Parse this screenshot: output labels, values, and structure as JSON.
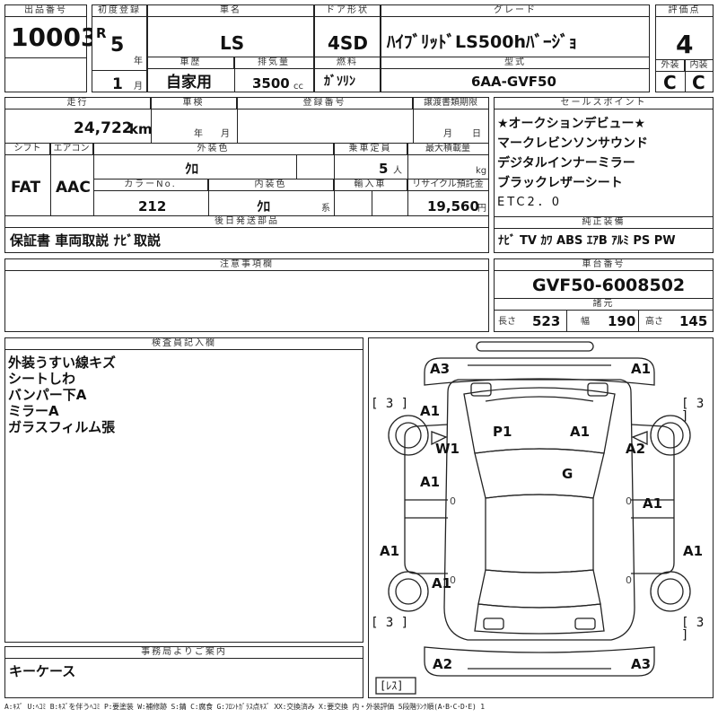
{
  "sheet": {
    "lot_label": "出品番号",
    "lot_number": "10003",
    "first_reg_label": "初度登録",
    "era": "R",
    "year": "5",
    "year_unit": "年",
    "month": "1",
    "month_unit": "月",
    "car_name_label": "車名",
    "car_name": "LS",
    "door_label": "ドア形状",
    "door": "4SD",
    "grade_label": "グレード",
    "grade": "ﾊｲﾌﾞﾘｯﾄﾞLS500hﾊﾞｰｼﾞｮ",
    "score_label": "評価点",
    "score": "4",
    "history_label": "車歴",
    "history": "自家用",
    "displacement_label": "排気量",
    "displacement": "3500",
    "displacement_unit": "cc",
    "fuel_label": "燃料",
    "fuel": "ｶﾞｿﾘﾝ",
    "model_label": "型式",
    "model": "6AA-GVF50",
    "exterior_label": "外装",
    "exterior_grade": "C",
    "interior_label": "内装",
    "interior_grade": "C"
  },
  "details": {
    "mileage_label": "走行",
    "mileage": "24,722",
    "mileage_unit": "km",
    "inspection_label": "車検",
    "inspection_year_unit": "年",
    "inspection_month_unit": "月",
    "reg_number_label": "登録番号",
    "transfer_label": "譲渡書類期限",
    "transfer_month_unit": "月",
    "transfer_day_unit": "日",
    "shift_label": "シフト",
    "shift": "FAT",
    "ac_label": "エアコン",
    "ac": "AAC",
    "ext_color_label": "外装色",
    "ext_color": "ｸﾛ",
    "capacity_label": "乗車定員",
    "capacity": "5",
    "capacity_unit": "人",
    "load_label": "最大積載量",
    "load_unit": "kg",
    "color_no_label": "カラーNo.",
    "color_no": "212",
    "int_color_label": "内装色",
    "int_color": "ｸﾛ",
    "int_color_unit": "系",
    "import_label": "輸入車",
    "recycle_label": "リサイクル預託金",
    "recycle": "19,560",
    "recycle_unit": "円",
    "later_label": "後日発送部品",
    "later_items": "保証書 車両取説 ﾅﾋﾞ取説"
  },
  "selling_points": {
    "label": "セールスポイント",
    "items": [
      "★オークションデビュー★",
      "マークレビンソンサウンド",
      "デジタルインナーミラー",
      "ブラックレザーシート",
      "ETC2．0"
    ]
  },
  "equipment": {
    "label": "純正装備",
    "items": "ﾅﾋﾞ TV ｶﾜ ABS ｴｱB ｱﾙﾐ PS PW"
  },
  "notes": {
    "label": "注意事項欄"
  },
  "chassis": {
    "label": "車台番号",
    "number": "GVF50-6008502",
    "spec_label": "諸元",
    "length_label": "長さ",
    "length": "523",
    "width_label": "幅",
    "width": "190",
    "height_label": "高さ",
    "height": "145"
  },
  "inspector": {
    "label": "検査員記入欄",
    "lines": [
      "外装うすい線キズ",
      "シートしわ",
      "バンパー下A",
      "ミラーA",
      "ガラスフィルム張"
    ]
  },
  "office": {
    "label": "事務局よりご案内",
    "text": "キーケース"
  },
  "diagram": {
    "marks": {
      "front_left": "A3",
      "front_right": "A1",
      "rear_left": "A2",
      "rear_right": "A3",
      "hood_left": "A1",
      "hood_right": "A1",
      "fender_left": "W1",
      "roof_left": "P1",
      "roof_right": "A1",
      "fender_right": "A2",
      "glass": "G",
      "door_fl": "A1",
      "door_fr": "A1",
      "sill_left": "A1",
      "sill_right": "A1",
      "door_rl": "A1",
      "tire_fl": "[ 3 ]",
      "tire_fr": "[ 3 ]",
      "tire_rl": "[ 3 ]",
      "tire_rr": "[ 3 ]",
      "spare": "[ﾚｽ]",
      "zero_1": "0",
      "zero_2": "0",
      "zero_3": "0",
      "zero_4": "0"
    }
  },
  "legend": "A:ｷｽﾞ U:ﾍｺﾐ B:ｷｽﾞを伴うﾍｺﾐ P:要塗装 W:補修跡 S:錆 C:腐食 G:ﾌﾛﾝﾄｶﾞﾗｽ点ｷｽﾞ XX:交換済み X:要交換 内・外装評価 5段階ﾗﾝｸ順(A･B･C･D･E) 1"
}
